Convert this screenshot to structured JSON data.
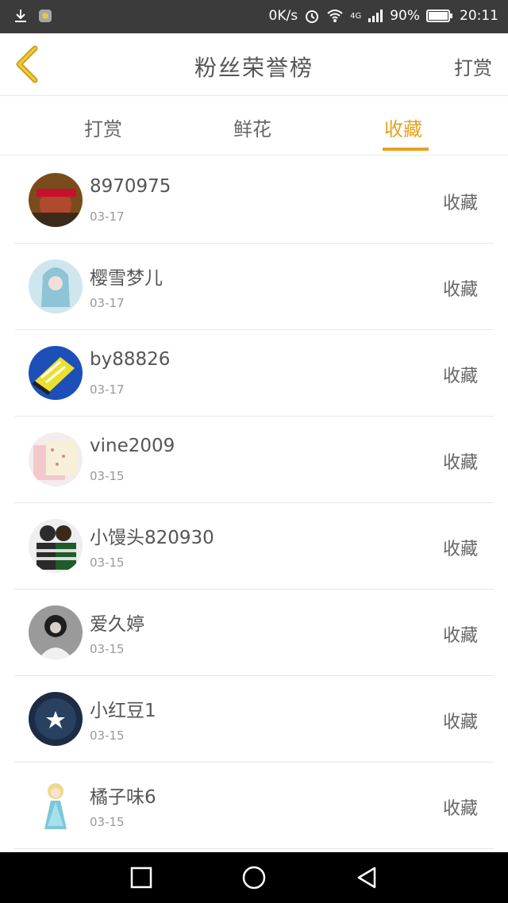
{
  "status_bar": {
    "network_speed": "0K/s",
    "network_type": "4G",
    "battery": "90%",
    "time": "20:11"
  },
  "header": {
    "title": "粉丝荣誉榜",
    "right_action": "打赏"
  },
  "tabs": [
    {
      "label": "打赏",
      "active": false
    },
    {
      "label": "鲜花",
      "active": false
    },
    {
      "label": "收藏",
      "active": true
    }
  ],
  "accent_color": "#e8a21e",
  "list": [
    {
      "name": "8970975",
      "date": "03-17",
      "action": "收藏"
    },
    {
      "name": "樱雪梦儿",
      "date": "03-17",
      "action": "收藏"
    },
    {
      "name": "by88826",
      "date": "03-17",
      "action": "收藏"
    },
    {
      "name": "vine2009",
      "date": "03-15",
      "action": "收藏"
    },
    {
      "name": "小馒头820930",
      "date": "03-15",
      "action": "收藏"
    },
    {
      "name": "爱久婷",
      "date": "03-15",
      "action": "收藏"
    },
    {
      "name": "小红豆1",
      "date": "03-15",
      "action": "收藏"
    },
    {
      "name": "橘子味6",
      "date": "03-15",
      "action": "收藏"
    }
  ]
}
